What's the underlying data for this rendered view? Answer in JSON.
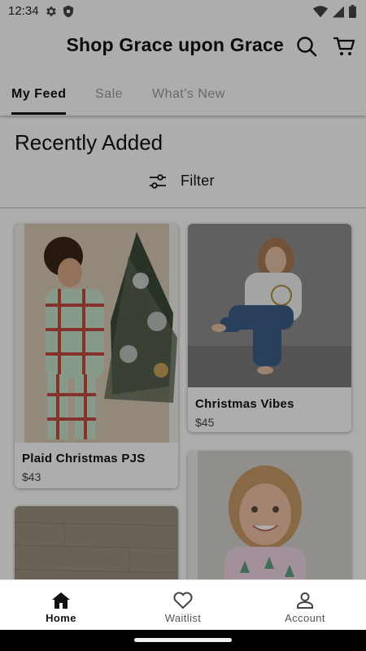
{
  "status_bar": {
    "time": "12:34"
  },
  "app_bar": {
    "title": "Shop Grace upon Grace"
  },
  "tabs": [
    {
      "label": "My Feed",
      "active": true
    },
    {
      "label": "Sale",
      "active": false
    },
    {
      "label": "What's New",
      "active": false
    }
  ],
  "section": {
    "title": "Recently Added",
    "filter_label": "Filter"
  },
  "products": [
    {
      "name": "Plaid Christmas PJS",
      "price": "$43"
    },
    {
      "name": "Christmas Vibes",
      "price": "$45"
    },
    {
      "name": "",
      "price": ""
    },
    {
      "name": "",
      "price": ""
    }
  ],
  "bottom_nav": [
    {
      "label": "Home",
      "icon": "home-icon",
      "active": true
    },
    {
      "label": "Waitlist",
      "icon": "heart-icon",
      "active": false
    },
    {
      "label": "Account",
      "icon": "account-icon",
      "active": false
    }
  ],
  "colors": {
    "scrim": "#00000052",
    "text": "#111111",
    "inactive_tab": "#9a9a9a"
  }
}
